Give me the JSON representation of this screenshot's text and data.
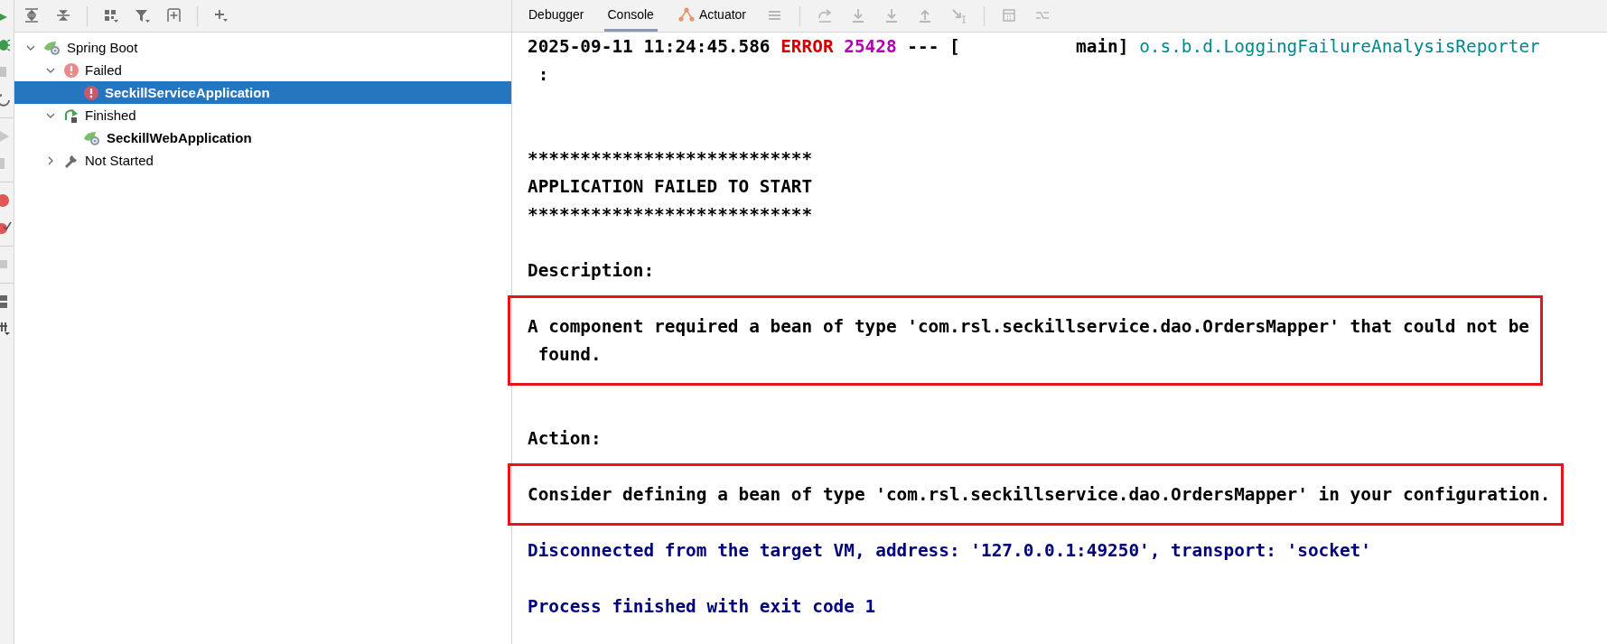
{
  "left_toolbar": {
    "buttons": [
      {
        "kind": "expand-all"
      },
      {
        "kind": "collapse-all"
      },
      {
        "kind": "group"
      },
      {
        "kind": "filter"
      },
      {
        "kind": "add-frame"
      },
      {
        "kind": "add"
      }
    ]
  },
  "tree": [
    {
      "label": "Spring Boot",
      "kind": "spring",
      "bold": false,
      "selected": false,
      "expanded": true,
      "children": [
        {
          "label": "Failed",
          "kind": "error",
          "bold": false,
          "selected": false,
          "expanded": true,
          "children": [
            {
              "label": "SeckillServiceApplication",
              "kind": "error",
              "bold": true,
              "selected": true
            }
          ]
        },
        {
          "label": "Finished",
          "kind": "restart",
          "bold": false,
          "selected": false,
          "expanded": true,
          "children": [
            {
              "label": "SeckillWebApplication",
              "kind": "spring",
              "bold": true,
              "selected": false
            }
          ]
        },
        {
          "label": "Not Started",
          "kind": "wrench",
          "bold": false,
          "selected": false,
          "expanded": false
        }
      ]
    }
  ],
  "tabs": [
    {
      "label": "Debugger",
      "selected": false
    },
    {
      "label": "Console",
      "selected": true
    },
    {
      "label": "Actuator",
      "selected": false,
      "kind": "actuator"
    }
  ],
  "console_toolbar": [
    {
      "kind": "menu"
    },
    {
      "kind": "sep"
    },
    {
      "kind": "step-over"
    },
    {
      "kind": "step-into"
    },
    {
      "kind": "force-step-into"
    },
    {
      "kind": "step-out"
    },
    {
      "kind": "run-to-cursor"
    },
    {
      "kind": "sep"
    },
    {
      "kind": "evaluate"
    },
    {
      "kind": "trace"
    }
  ],
  "console": [
    {
      "highlighted": false,
      "lines": [
        {
          "segments": [
            {
              "text": "2025-09-11 11:24:45.586 ",
              "kind": "plain"
            },
            {
              "text": "ERROR",
              "kind": "error"
            },
            {
              "text": " 25428",
              "kind": "pid"
            },
            {
              "text": " --- [           main] ",
              "kind": "plain"
            },
            {
              "text": "o.s.b.d.LoggingFailureAnalysisReporter",
              "kind": "logger"
            }
          ]
        },
        {
          "segments": [
            {
              "text": " :",
              "kind": "plain"
            }
          ]
        },
        {
          "kind": "blank"
        },
        {
          "kind": "blank"
        },
        {
          "segments": [
            {
              "text": "***************************",
              "kind": "plain"
            }
          ]
        },
        {
          "segments": [
            {
              "text": "APPLICATION FAILED TO START",
              "kind": "plain"
            }
          ]
        },
        {
          "segments": [
            {
              "text": "***************************",
              "kind": "plain"
            }
          ]
        },
        {
          "kind": "blank"
        },
        {
          "segments": [
            {
              "text": "Description:",
              "kind": "plain"
            }
          ]
        },
        {
          "kind": "blank"
        }
      ]
    },
    {
      "highlighted": true,
      "lines": [
        {
          "segments": [
            {
              "text": "A component required a bean of type 'com.rsl.seckillservice.dao.OrdersMapper' that could not be",
              "kind": "plain"
            }
          ]
        },
        {
          "segments": [
            {
              "text": " found.",
              "kind": "plain"
            }
          ]
        }
      ]
    },
    {
      "highlighted": false,
      "lines": [
        {
          "kind": "blank"
        },
        {
          "kind": "blank"
        },
        {
          "segments": [
            {
              "text": "Action:",
              "kind": "plain"
            }
          ]
        },
        {
          "kind": "blank"
        }
      ]
    },
    {
      "highlighted": true,
      "lines": [
        {
          "segments": [
            {
              "text": "Consider defining a bean of type 'com.rsl.seckillservice.dao.OrdersMapper' in your configuration.",
              "kind": "plain"
            }
          ]
        }
      ]
    },
    {
      "highlighted": false,
      "lines": [
        {
          "kind": "blank"
        },
        {
          "segments": [
            {
              "text": "Disconnected from the target VM, address: '127.0.0.1:49250', transport: 'socket'",
              "kind": "info"
            }
          ]
        },
        {
          "kind": "blank"
        },
        {
          "segments": [
            {
              "text": "Process finished with exit code 1",
              "kind": "info"
            }
          ]
        }
      ]
    }
  ]
}
